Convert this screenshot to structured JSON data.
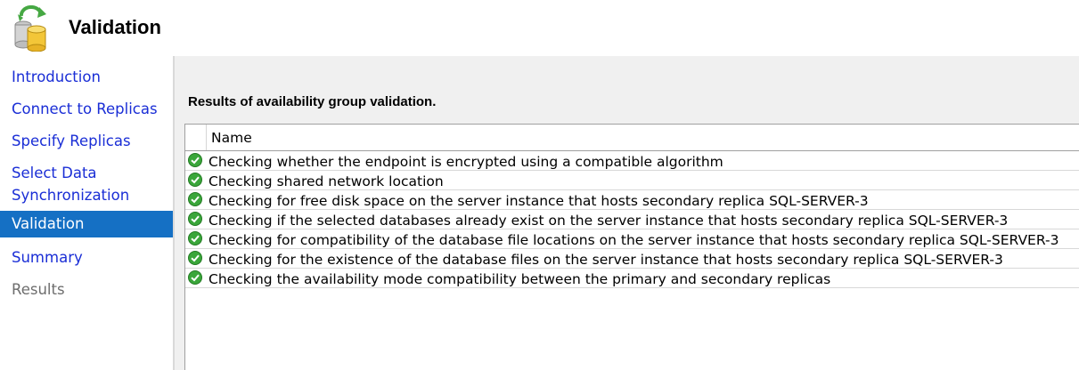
{
  "header": {
    "title": "Validation",
    "icon": "database-wizard-icon"
  },
  "sidebar": {
    "items": [
      {
        "label": "Introduction",
        "state": "link"
      },
      {
        "label": "Connect to Replicas",
        "state": "link"
      },
      {
        "label": "Specify Replicas",
        "state": "link"
      },
      {
        "label": "Select Data\nSynchronization",
        "state": "link"
      },
      {
        "label": "Validation",
        "state": "active"
      },
      {
        "label": "Summary",
        "state": "link"
      },
      {
        "label": "Results",
        "state": "disabled"
      }
    ]
  },
  "main": {
    "results_label": "Results of availability group validation.",
    "grid": {
      "column_name": "Name",
      "rows": [
        {
          "status": "success",
          "name": "Checking whether the endpoint is encrypted using a compatible algorithm"
        },
        {
          "status": "success",
          "name": "Checking shared network location"
        },
        {
          "status": "success",
          "name": "Checking for free disk space on the server instance that hosts secondary replica SQL-SERVER-3"
        },
        {
          "status": "success",
          "name": "Checking if the selected databases already exist on the server instance that hosts secondary replica SQL-SERVER-3"
        },
        {
          "status": "success",
          "name": "Checking for compatibility of the database file locations on the server instance that hosts secondary replica SQL-SERVER-3"
        },
        {
          "status": "success",
          "name": "Checking for the existence of the database files on the server instance that hosts secondary replica SQL-SERVER-3"
        },
        {
          "status": "success",
          "name": "Checking the availability mode compatibility between the primary and secondary replicas"
        }
      ]
    }
  },
  "colors": {
    "link": "#1a2ed6",
    "active_bg": "#1570c4",
    "success": "#3aa63a"
  }
}
